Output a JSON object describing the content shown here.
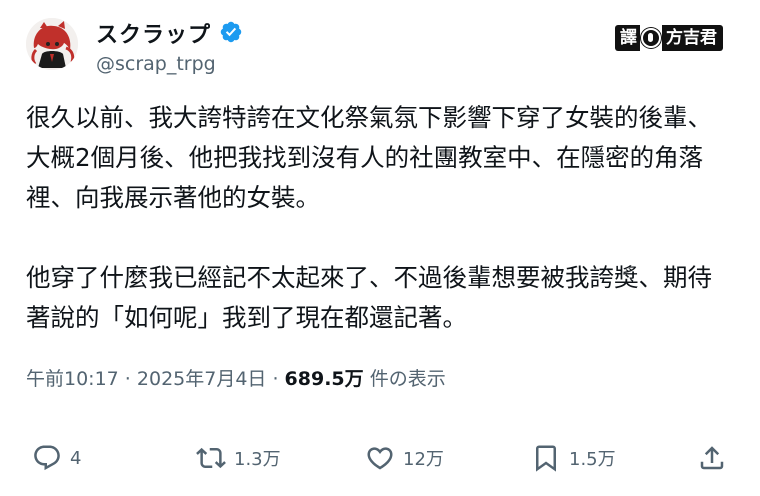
{
  "author": {
    "display_name": "スクラップ",
    "handle": "@scrap_trpg",
    "verified": true,
    "verified_color": "#1d9bf0"
  },
  "watermark": {
    "left_text": "譯",
    "right_text": "方吉君"
  },
  "tweet": {
    "paragraph1_line1": "很久以前、我大誇特誇在文化祭氣氛下影響下穿了女裝的後輩、",
    "paragraph1_line2": "大概2個月後、他把我找到沒有人的社團教室中、在隱密的角落",
    "paragraph1_line3": "裡、向我展示著他的女裝。",
    "paragraph2_line1": "他穿了什麼我已經記不太起來了、不過後輩想要被我誇獎、期待",
    "paragraph2_line2": "著說的「如何呢」我到了現在都還記著。"
  },
  "meta": {
    "time": "午前10:17",
    "separator1": " · ",
    "date": "2025年7月4日",
    "separator2": " · ",
    "views": "689.5万",
    "views_suffix": " 件の表示"
  },
  "actions": {
    "reply_count": "4",
    "retweet_count": "1.3万",
    "like_count": "12万",
    "bookmark_count": "1.5万",
    "icon_color": "#536471"
  }
}
